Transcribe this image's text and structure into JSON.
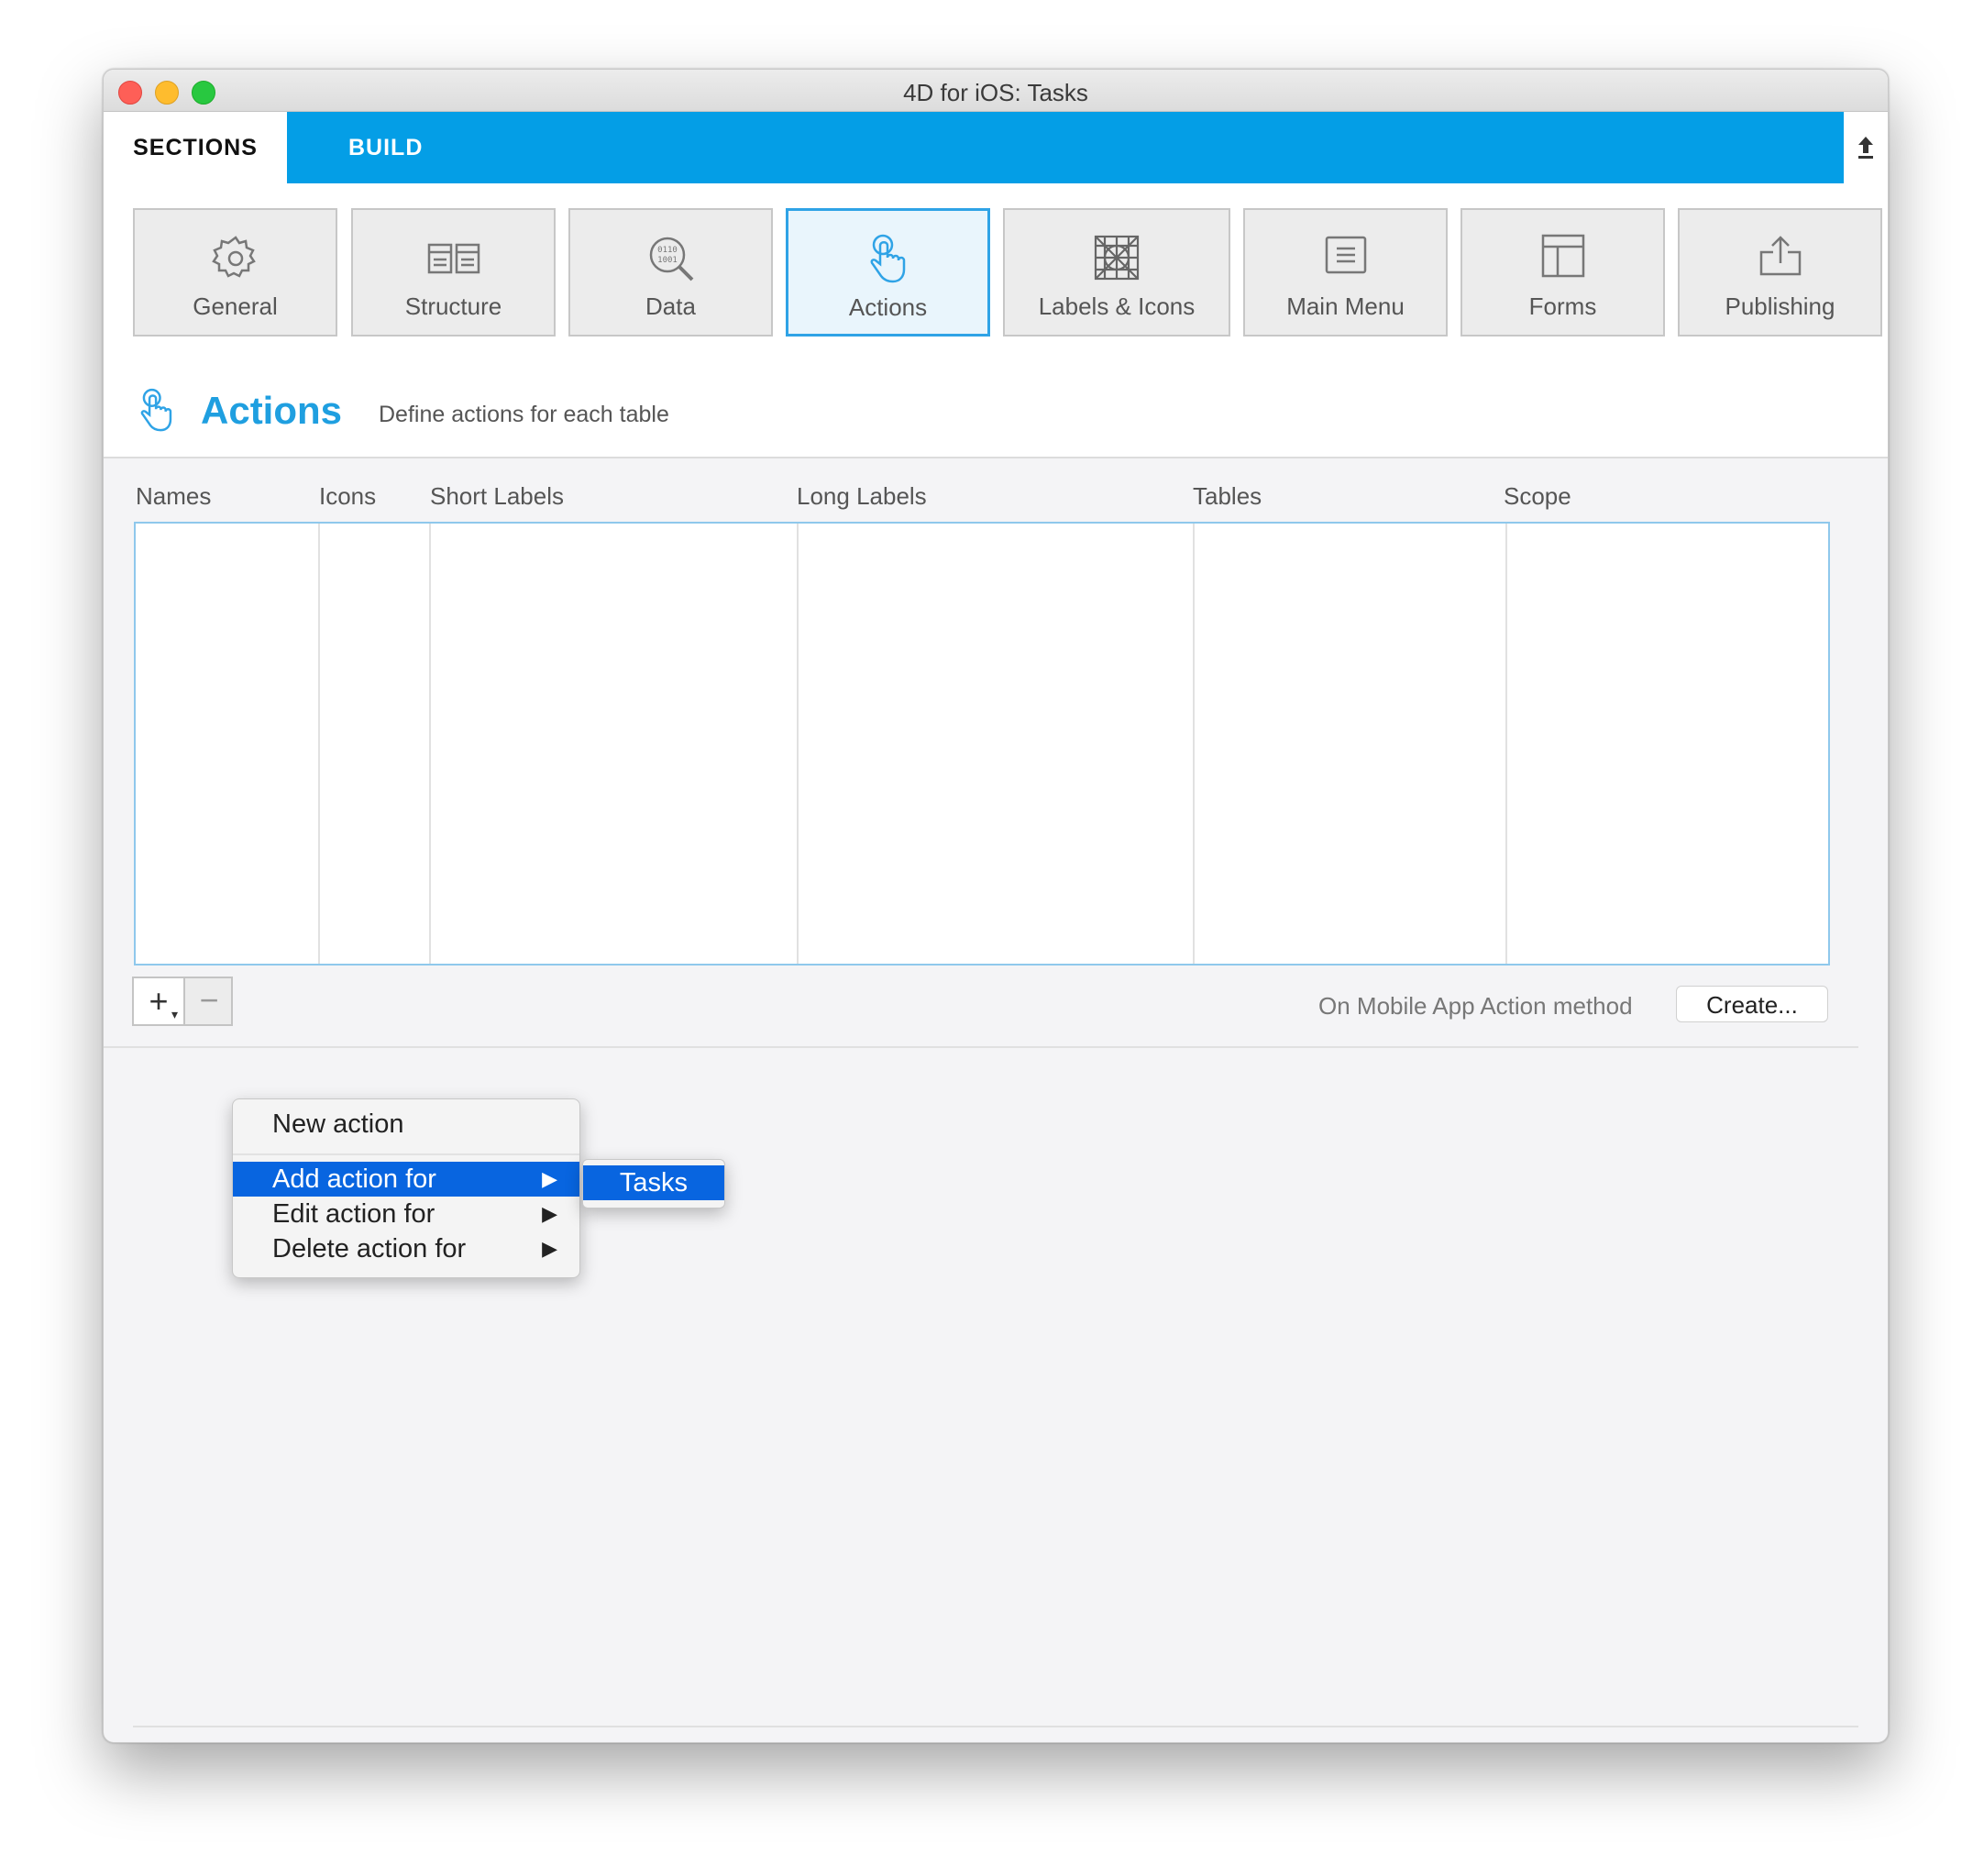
{
  "window": {
    "title": "4D for iOS: Tasks"
  },
  "tabs": {
    "sections": "SECTIONS",
    "build": "BUILD"
  },
  "toolbar": [
    {
      "id": "general",
      "label": "General",
      "icon": "gear-icon"
    },
    {
      "id": "structure",
      "label": "Structure",
      "icon": "structure-icon"
    },
    {
      "id": "data",
      "label": "Data",
      "icon": "data-search-icon"
    },
    {
      "id": "actions",
      "label": "Actions",
      "icon": "touch-hand-icon",
      "selected": true
    },
    {
      "id": "labels-icons",
      "label": "Labels & Icons",
      "icon": "labels-icon"
    },
    {
      "id": "main-menu",
      "label": "Main Menu",
      "icon": "menu-list-icon"
    },
    {
      "id": "forms",
      "label": "Forms",
      "icon": "forms-layout-icon"
    },
    {
      "id": "publishing",
      "label": "Publishing",
      "icon": "share-upload-icon"
    }
  ],
  "header": {
    "title": "Actions",
    "description": "Define actions for each table"
  },
  "table": {
    "columns": [
      "Names",
      "Icons",
      "Short Labels",
      "Long Labels",
      "Tables",
      "Scope"
    ],
    "rows": []
  },
  "controls": {
    "add_symbol": "+",
    "remove_symbol": "−",
    "method_label": "On Mobile App Action method",
    "create_button": "Create..."
  },
  "menu": {
    "items": [
      {
        "label": "New action"
      },
      {
        "label": "Add action for",
        "highlighted": true
      },
      {
        "label": "Edit action for"
      },
      {
        "label": "Delete action for"
      }
    ],
    "submenu": [
      {
        "label": "Tasks",
        "highlighted": true
      }
    ]
  },
  "colors": {
    "accent": "#049ee6",
    "selection": "#0865e0",
    "header_title": "#1f9fe0"
  }
}
